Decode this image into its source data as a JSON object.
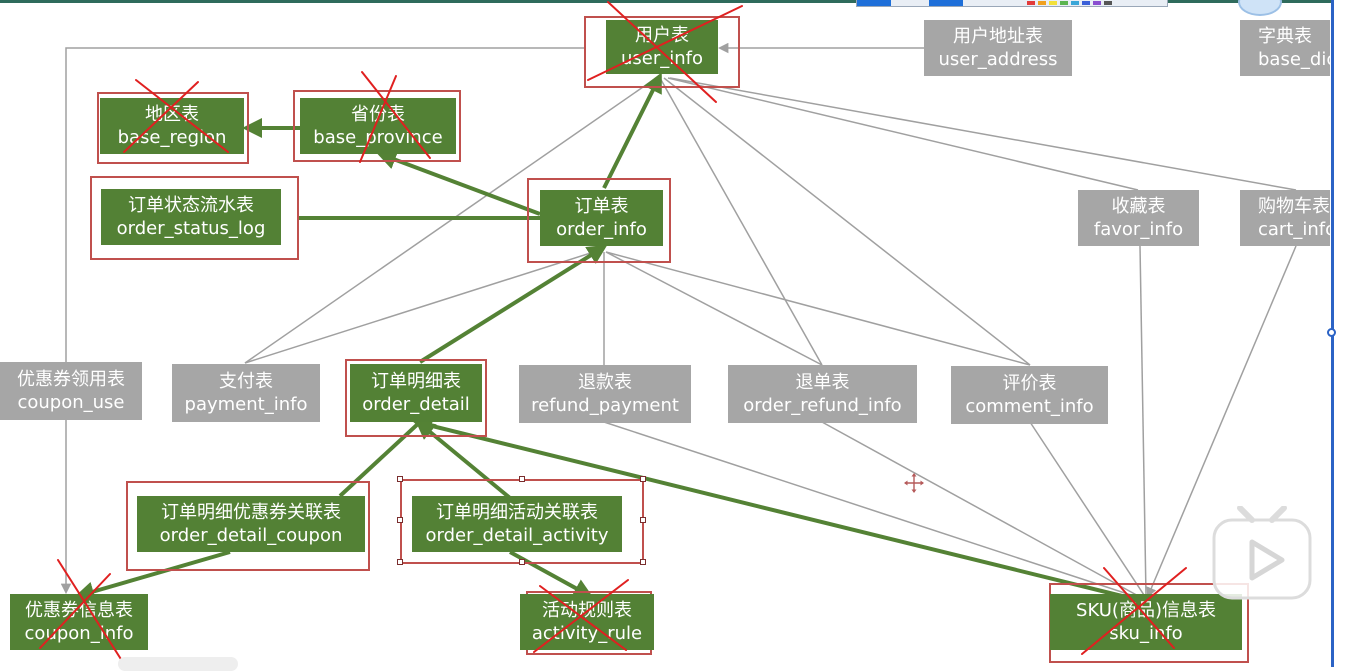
{
  "nodes": {
    "user_info": {
      "cn": "用户表",
      "en": "user_info"
    },
    "user_address": {
      "cn": "用户地址表",
      "en": "user_address"
    },
    "base_dic": {
      "cn": "字典表",
      "en": "base_dic"
    },
    "base_region": {
      "cn": "地区表",
      "en": "base_region"
    },
    "base_province": {
      "cn": "省份表",
      "en": "base_province"
    },
    "order_status_log": {
      "cn": "订单状态流水表",
      "en": "order_status_log"
    },
    "order_info": {
      "cn": "订单表",
      "en": "order_info"
    },
    "favor_info": {
      "cn": "收藏表",
      "en": "favor_info"
    },
    "cart_info": {
      "cn": "购物车表",
      "en": "cart_info"
    },
    "coupon_use": {
      "cn": "优惠券领用表",
      "en": "coupon_use"
    },
    "payment_info": {
      "cn": "支付表",
      "en": "payment_info"
    },
    "order_detail": {
      "cn": "订单明细表",
      "en": "order_detail"
    },
    "refund_payment": {
      "cn": "退款表",
      "en": "refund_payment"
    },
    "order_refund_info": {
      "cn": "退单表",
      "en": "order_refund_info"
    },
    "comment_info": {
      "cn": "评价表",
      "en": "comment_info"
    },
    "order_detail_coupon": {
      "cn": "订单明细优惠券关联表",
      "en": "order_detail_coupon"
    },
    "order_detail_activity": {
      "cn": "订单明细活动关联表",
      "en": "order_detail_activity"
    },
    "coupon_info": {
      "cn": "优惠券信息表",
      "en": "coupon_info"
    },
    "activity_rule": {
      "cn": "活动规则表",
      "en": "activity_rule"
    },
    "sku_info": {
      "cn": "SKU(商品)信息表",
      "en": "sku_info"
    }
  },
  "colors": {
    "green_node": "#538135",
    "gray_node": "#a6a6a6",
    "green_edge": "#548235",
    "gray_edge": "#a0a0a0",
    "red_mark": "#c0504d",
    "red_cross": "#e02020"
  },
  "icons": [
    "play-icon",
    "move-cursor-icon"
  ]
}
